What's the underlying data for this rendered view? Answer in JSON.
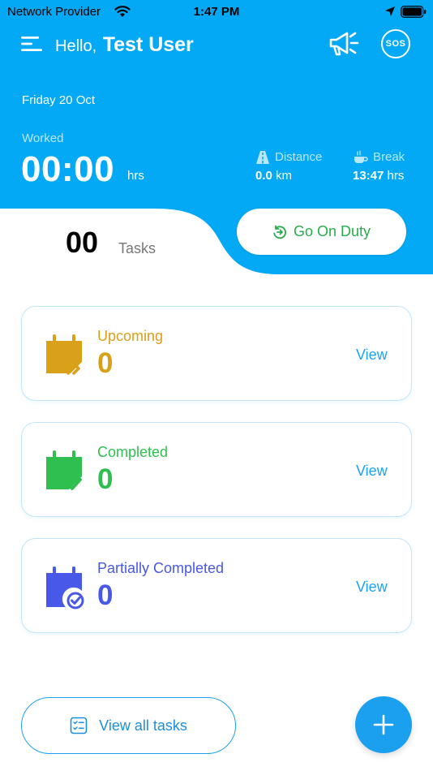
{
  "status_bar": {
    "carrier": "Network Provider",
    "time": "1:47 PM"
  },
  "header": {
    "greeting_prefix": "Hello,",
    "user_name": "Test User",
    "sos_label": "SOS",
    "date": "Friday 20 Oct",
    "worked_label": "Worked",
    "worked_value": "00:00",
    "worked_unit": "hrs",
    "distance_label": "Distance",
    "distance_value": "0.0",
    "distance_unit": "km",
    "break_label": "Break",
    "break_value": "13:47",
    "break_unit": "hrs"
  },
  "tasks": {
    "count": "00",
    "label": "Tasks"
  },
  "duty_button": {
    "label": "Go On Duty"
  },
  "cards": [
    {
      "title": "Upcoming",
      "count": "0",
      "view_label": "View",
      "color": "#d9a01a"
    },
    {
      "title": "Completed",
      "count": "0",
      "view_label": "View",
      "color": "#2fbf4f"
    },
    {
      "title": "Partially Completed",
      "count": "0",
      "view_label": "View",
      "color": "#4858e8"
    }
  ],
  "footer": {
    "view_all_label": "View all tasks"
  },
  "colors": {
    "primary": "#03a9f4",
    "accent_blue": "#1da1f2"
  },
  "icons": [
    "menu-icon",
    "megaphone-icon",
    "sos-icon",
    "road-icon",
    "coffee-icon",
    "duty-icon",
    "calendar-forward-icon",
    "calendar-check-icon",
    "calendar-partial-icon",
    "checklist-icon",
    "plus-icon"
  ]
}
